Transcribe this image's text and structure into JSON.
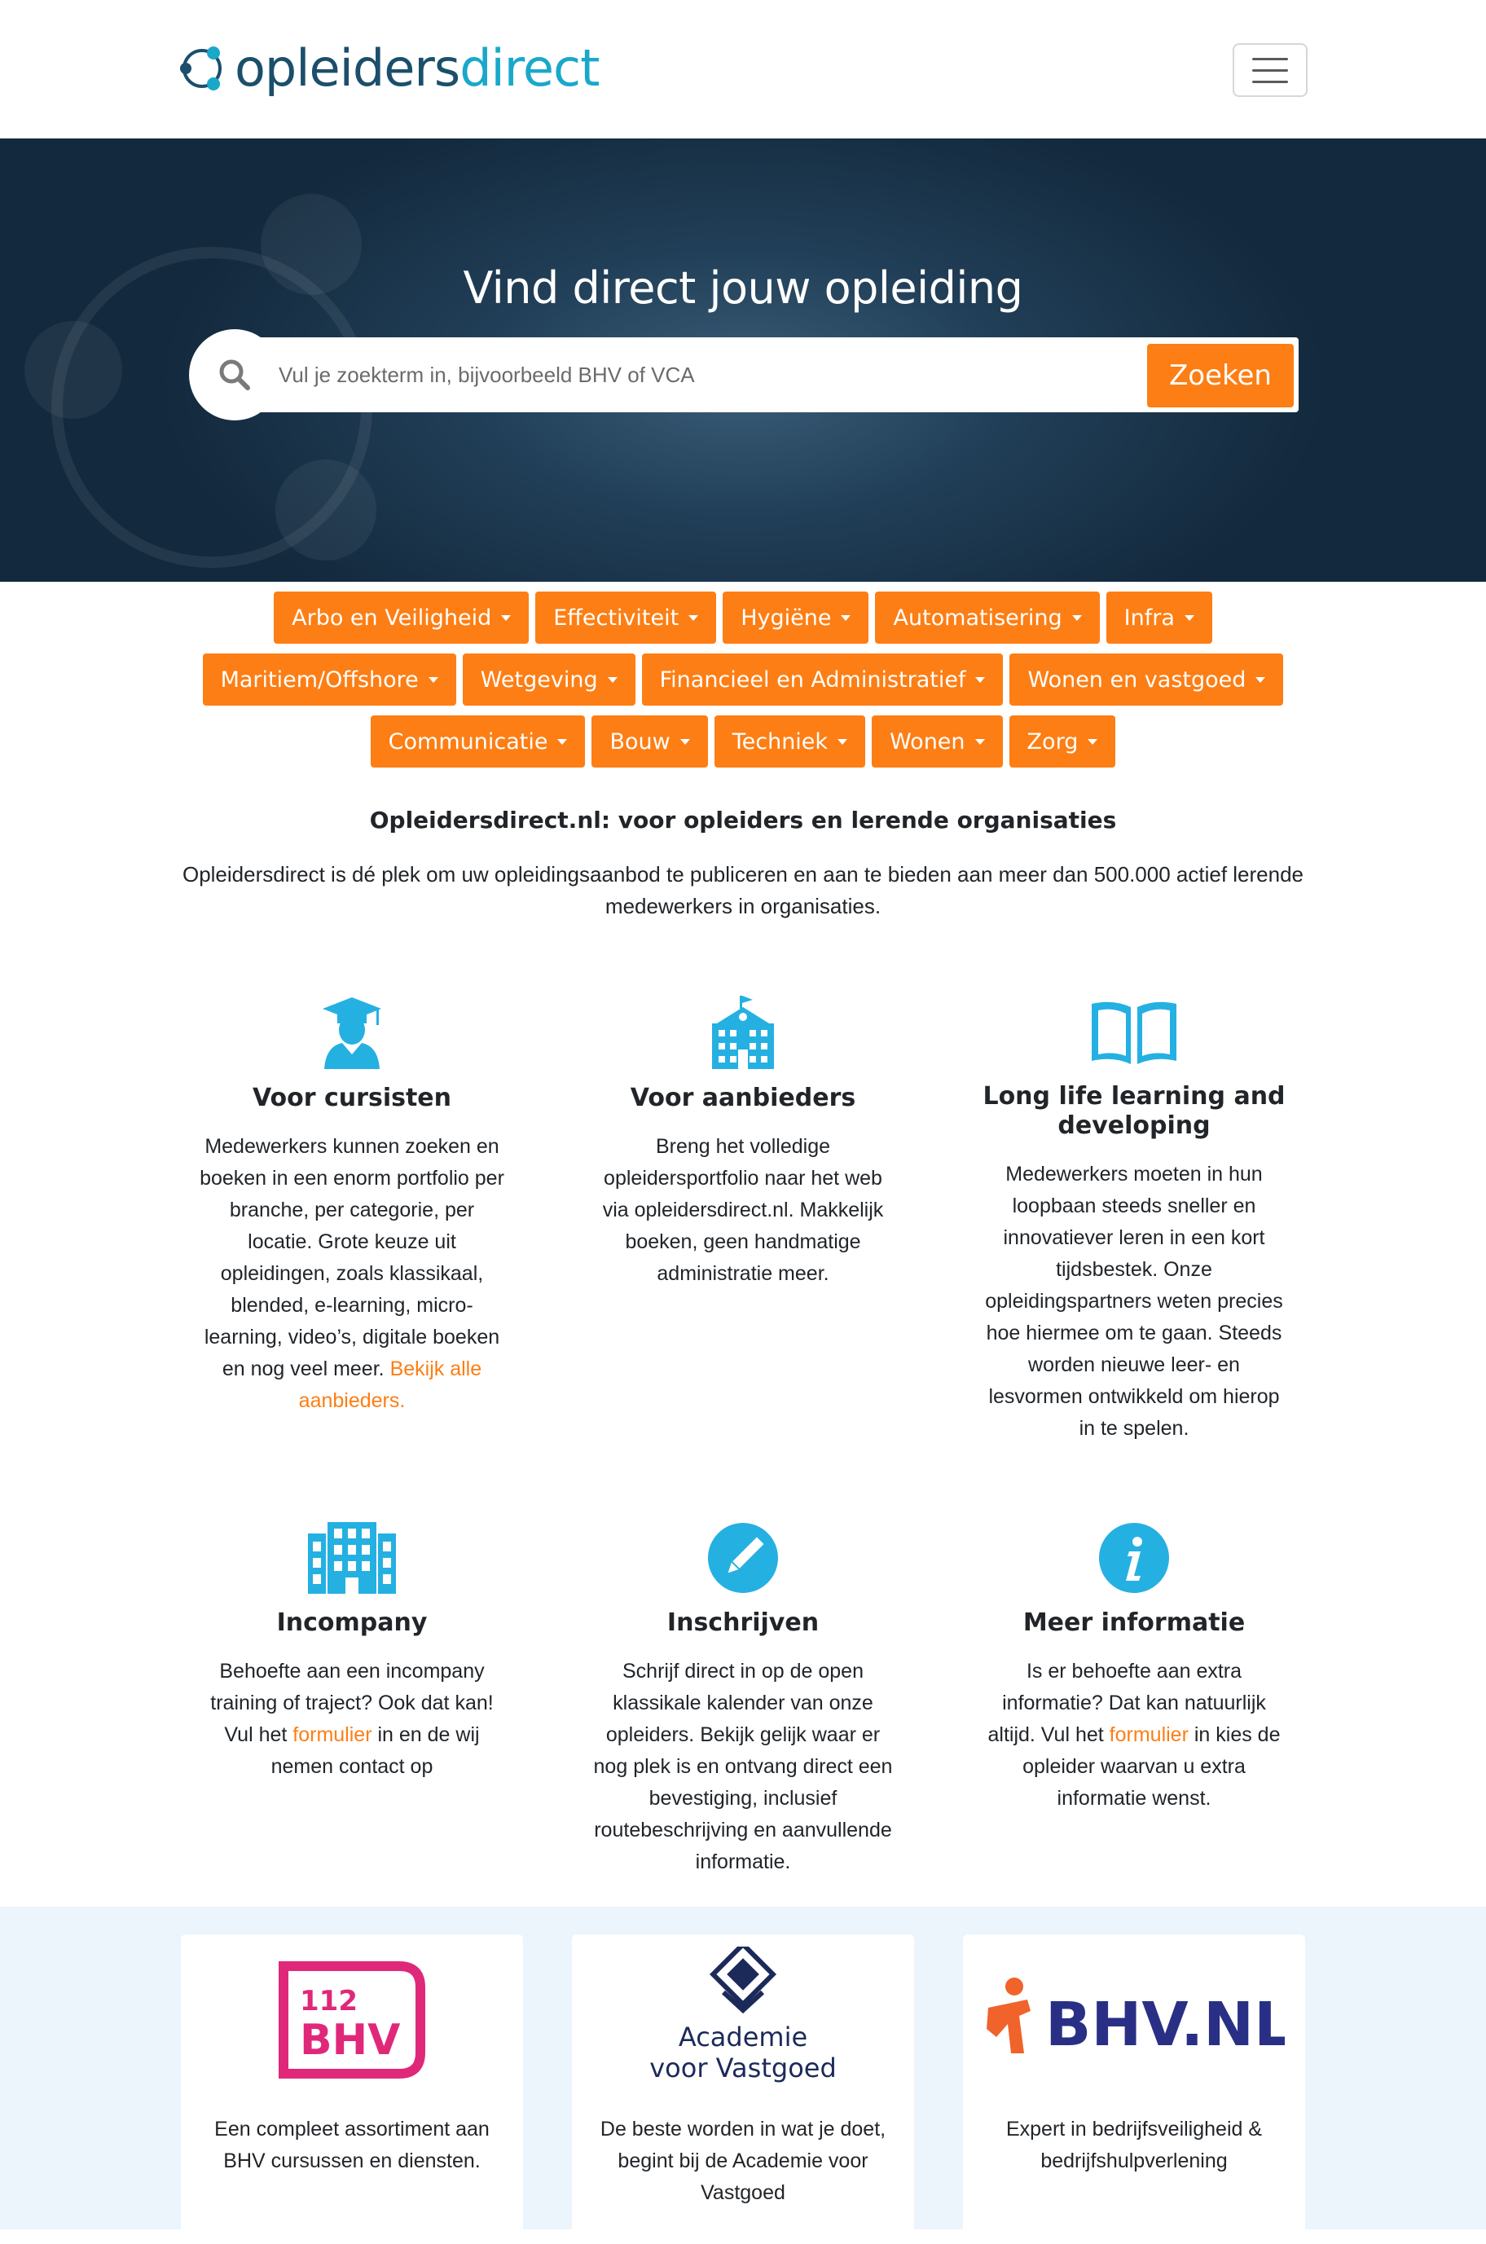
{
  "header": {
    "logo_text_main": "opleiders",
    "logo_text_accent": "direct",
    "menu_label": "menu"
  },
  "hero": {
    "title": "Vind direct jouw opleiding",
    "search_placeholder": "Vul je zoekterm in, bijvoorbeeld BHV of VCA",
    "search_button": "Zoeken"
  },
  "categories": [
    [
      "Arbo en Veiligheid",
      "Effectiviteit",
      "Hygiëne",
      "Automatisering",
      "Infra"
    ],
    [
      "Maritiem/Offshore",
      "Wetgeving",
      "Financieel en Administratief",
      "Wonen en vastgoed"
    ],
    [
      "Communicatie",
      "Bouw",
      "Techniek",
      "Wonen",
      "Zorg"
    ]
  ],
  "intro": {
    "title": "Opleidersdirect.nl: voor opleiders en lerende organisaties",
    "text": "Opleidersdirect is dé plek om uw opleidingsaanbod te publiceren en aan te bieden aan meer dan 500.000 actief lerende medewerkers in organisaties."
  },
  "features": {
    "cursisten": {
      "icon": "graduate-icon",
      "title": "Voor cursisten",
      "text": "Medewerkers kunnen zoeken en boeken in een enorm portfolio per branche, per categorie, per locatie. Grote keuze uit opleidingen, zoals klassikaal, blended, e-learning, micro-learning, video’s, digitale boeken en nog veel meer.",
      "link": "Bekijk alle aanbieders."
    },
    "aanbieders": {
      "icon": "school-building-icon",
      "title": "Voor aanbieders",
      "text": "Breng het volledige opleidersportfolio naar het web via opleidersdirect.nl. Makkelijk boeken, geen handmatige administratie meer."
    },
    "lifelong": {
      "icon": "open-book-icon",
      "title": "Long life learning and developing",
      "text": "Medewerkers moeten in hun loopbaan steeds sneller en innovatiever leren in een kort tijdsbestek. Onze opleidingspartners weten precies hoe hiermee om te gaan. Steeds worden nieuwe leer- en lesvormen ontwikkeld om hierop in te spelen."
    },
    "incompany": {
      "icon": "office-building-icon",
      "title": "Incompany",
      "text_before": "Behoefte aan een incompany training of traject? Ook dat kan! Vul het",
      "link": "formulier",
      "text_after": "in en de wij nemen contact op"
    },
    "inschrijven": {
      "icon": "pencil-icon",
      "title": "Inschrijven",
      "text": "Schrijf direct in op de open klassikale kalender van onze opleiders. Bekijk gelijk waar er nog plek is en ontvang direct een bevestiging, inclusief routebeschrijving en aanvullende informatie."
    },
    "meerinfo": {
      "icon": "info-icon",
      "title": "Meer informatie",
      "text_before": "Is er behoefte aan extra informatie? Dat kan natuurlijk altijd. Vul het",
      "link": "formulier",
      "text_after": "in kies de opleider waarvan u extra informatie wenst."
    }
  },
  "partners": [
    {
      "logo_top": "112",
      "logo_bottom": "BHV",
      "text": "Een compleet assortiment aan BHV cursussen en diensten."
    },
    {
      "logo_top": "Academie",
      "logo_bottom": "voor Vastgoed",
      "text": "De beste worden in wat je doet, begint bij de Academie voor Vastgoed"
    },
    {
      "logo_text": "BHV.NL",
      "text": "Expert in bedrijfsveiligheid & bedrijfshulpverlening"
    }
  ],
  "colors": {
    "accent": "#fd7e14",
    "icon_blue": "#25b0e2",
    "hero_dark": "#13293d",
    "partner_bg": "#ecf4fc"
  }
}
